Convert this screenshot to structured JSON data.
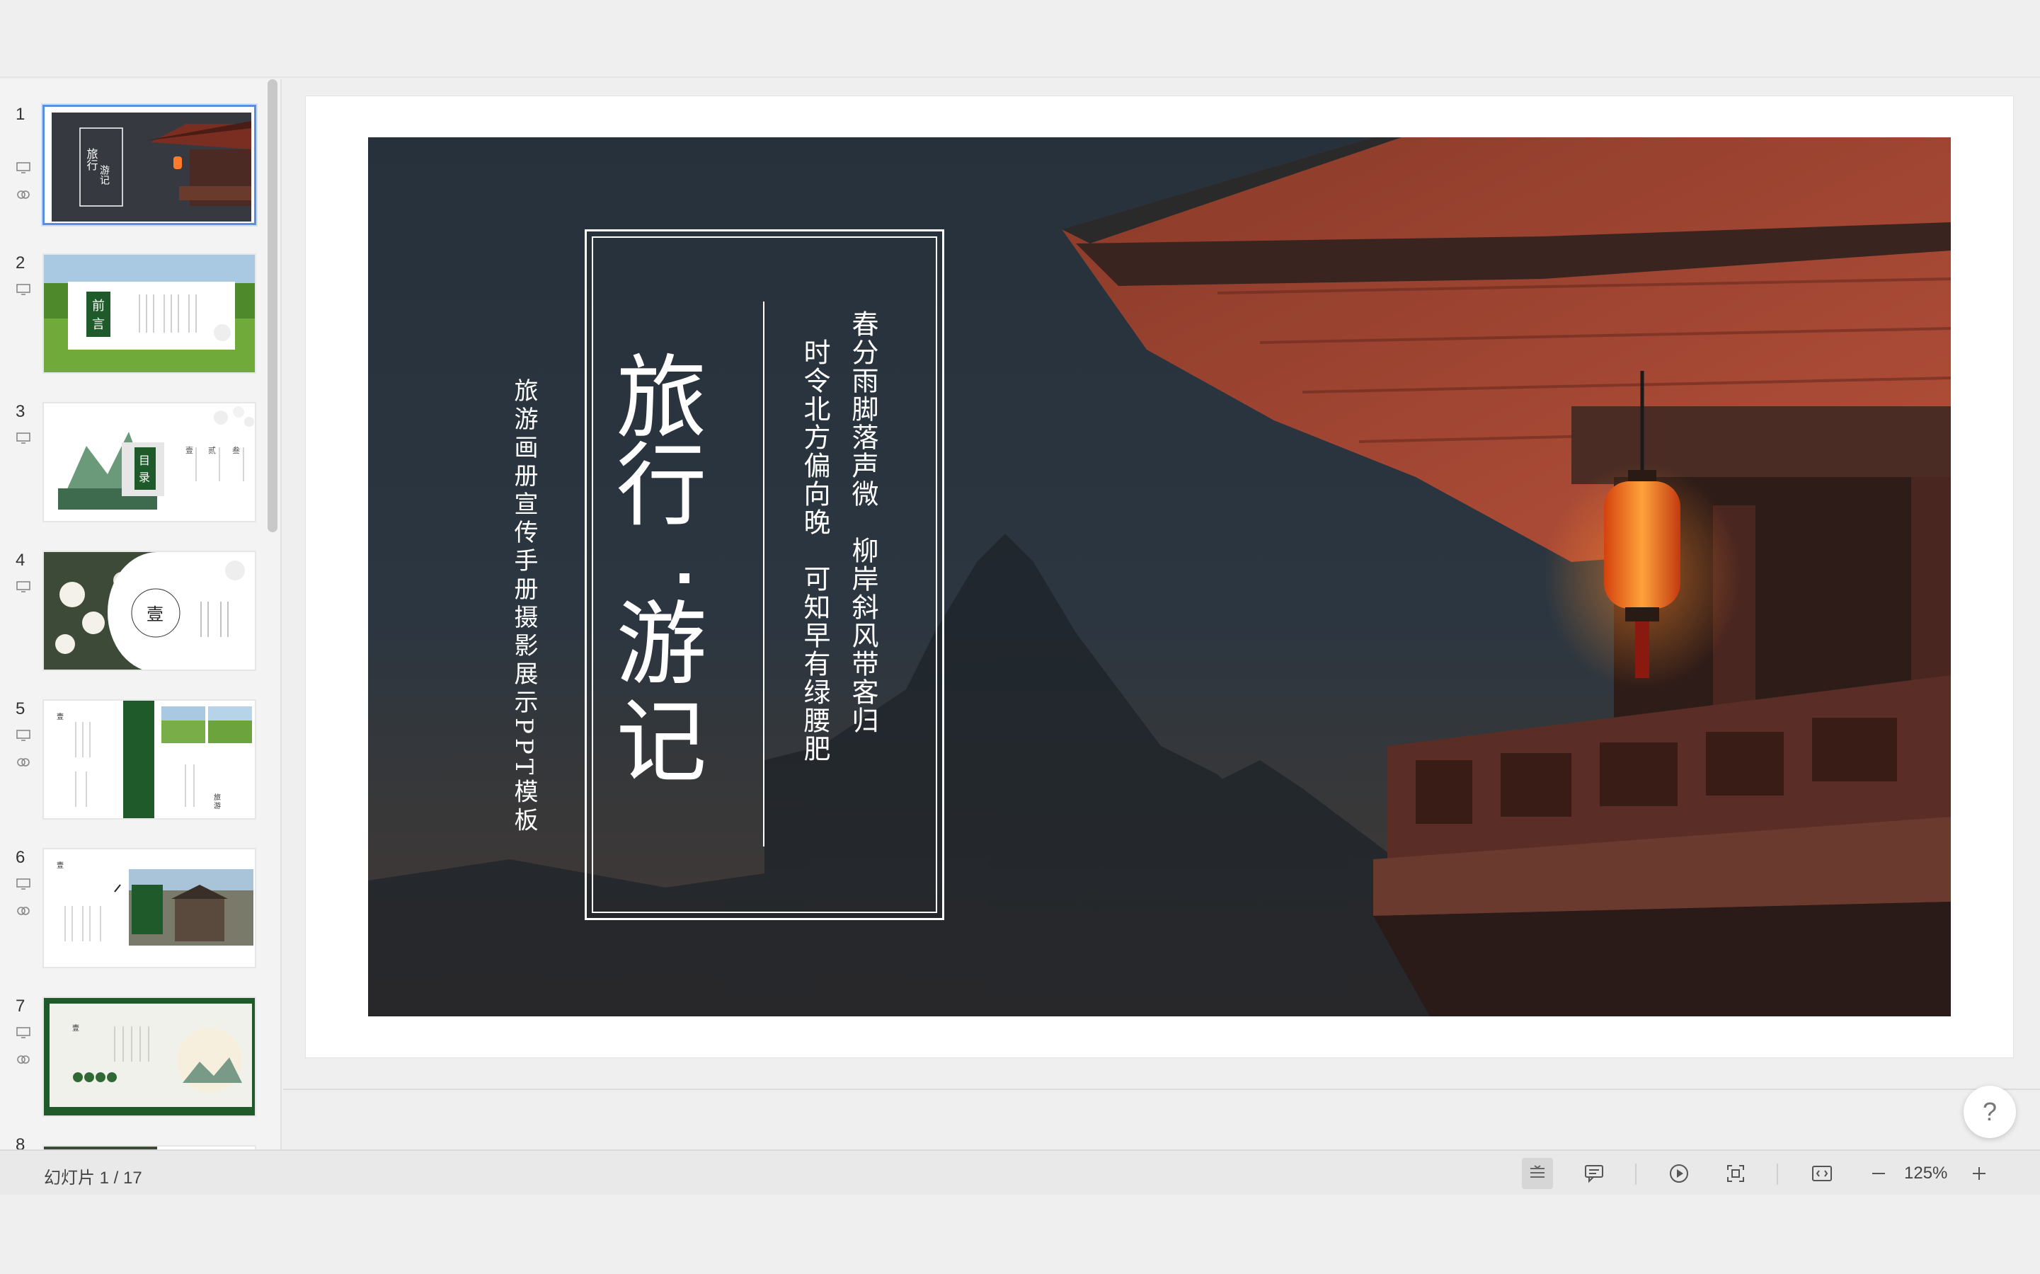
{
  "sidebar": {
    "slides": [
      {
        "num": "1",
        "title": "旅行·游记"
      },
      {
        "num": "2",
        "title": "前言"
      },
      {
        "num": "3",
        "title": "目录"
      },
      {
        "num": "4",
        "title": "壹"
      },
      {
        "num": "5",
        "title": "旅游"
      },
      {
        "num": "6",
        "title": ""
      },
      {
        "num": "7",
        "title": ""
      },
      {
        "num": "8",
        "title": ""
      }
    ]
  },
  "slide": {
    "subtitle": "旅游画册宣传手册摄影展示PPT模板",
    "title_line1": "旅行",
    "title_line2": "游记",
    "poem_col1": "春分雨脚落声微　柳岸斜风带客归",
    "poem_col2": "时令北方偏向晚　可知早有绿腰肥"
  },
  "statusbar": {
    "slide_counter": "幻灯片 1 / 17",
    "zoom": "125%"
  },
  "help": {
    "label": "?"
  },
  "colors": {
    "accent": "#5a8fe0",
    "green": "#1f5a2a"
  },
  "icons": [
    "notes-icon",
    "comment-icon",
    "play-icon",
    "fit-icon",
    "view-icon",
    "zoom-out-icon",
    "zoom-in-icon",
    "slide-note-icon",
    "transition-icon"
  ]
}
